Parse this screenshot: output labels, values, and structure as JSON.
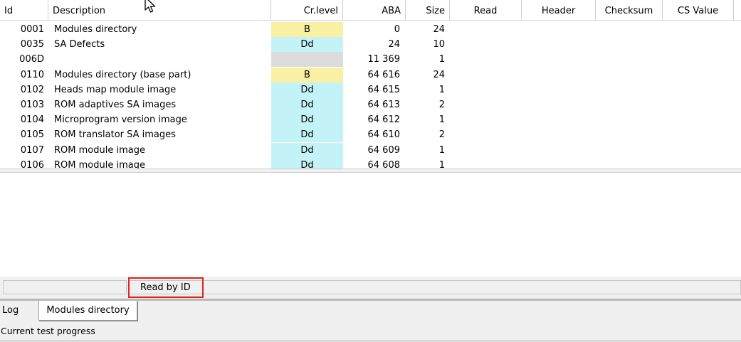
{
  "table": {
    "columns": [
      "Id",
      "Description",
      "Cr.level",
      "ABA",
      "Size",
      "Read",
      "Header",
      "Checksum",
      "CS Value"
    ],
    "rows": [
      {
        "id": "0001",
        "desc": "Modules directory",
        "level": "B",
        "level_color": "#faf0a4",
        "aba": "0",
        "size": "24"
      },
      {
        "id": "0035",
        "desc": "SA Defects",
        "level": "Dd",
        "level_color": "#c4f3f7",
        "aba": "24",
        "size": "10"
      },
      {
        "id": "006D",
        "desc": "",
        "level": "",
        "level_color": "#dcdcdc",
        "aba": "11 369",
        "size": "1"
      },
      {
        "id": "0110",
        "desc": "Modules directory (base part)",
        "level": "B",
        "level_color": "#faf0a4",
        "aba": "64 616",
        "size": "24"
      },
      {
        "id": "0102",
        "desc": "Heads map module image",
        "level": "Dd",
        "level_color": "#c4f3f7",
        "aba": "64 615",
        "size": "1"
      },
      {
        "id": "0103",
        "desc": "ROM adaptives SA images",
        "level": "Dd",
        "level_color": "#c4f3f7",
        "aba": "64 613",
        "size": "2"
      },
      {
        "id": "0104",
        "desc": "Microprogram version image",
        "level": "Dd",
        "level_color": "#c4f3f7",
        "aba": "64 612",
        "size": "1"
      },
      {
        "id": "0105",
        "desc": "ROM translator SA images",
        "level": "Dd",
        "level_color": "#c4f3f7",
        "aba": "64 610",
        "size": "2"
      },
      {
        "id": "0107",
        "desc": "ROM module image",
        "level": "Dd",
        "level_color": "#c4f3f7",
        "aba": "64 609",
        "size": "1"
      },
      {
        "id": "0106",
        "desc": "ROM module image",
        "level": "Dd",
        "level_color": "#c4f3f7",
        "aba": "64 608",
        "size": "1"
      }
    ]
  },
  "status": {
    "operation": "Read by ID",
    "highlight_color": "#e0261b"
  },
  "tabs": [
    "Log",
    "Modules directory"
  ],
  "progress_label": "Current test progress",
  "cursor_icon": "mouse-pointer-icon"
}
